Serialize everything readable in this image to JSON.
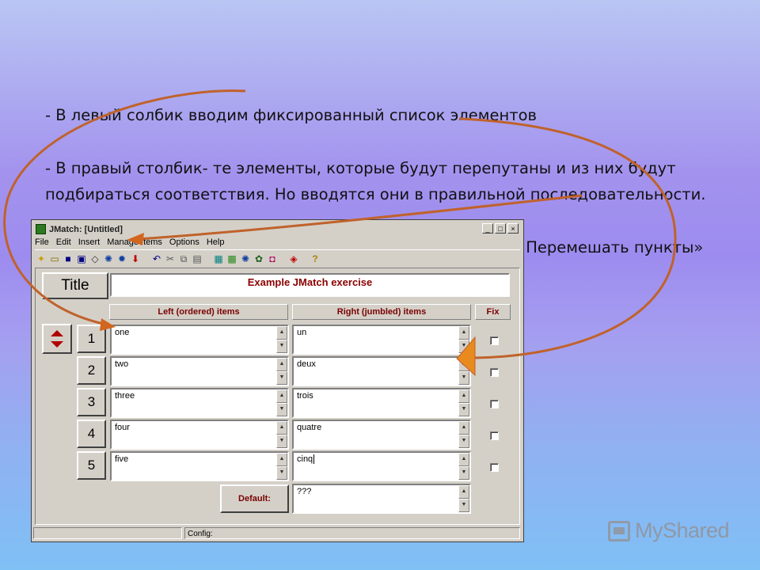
{
  "slide": {
    "lines": [
      "- В левый солбик вводим фиксированный список элементов",
      "- В правый столбик- те элементы, которые будут перепутаны и из них будут подбираться соответствия. Но вводятся они в правильной последовательности.",
      "- Во вкладке « Управление списком» выбираем команду « Перемешать пункты»"
    ]
  },
  "window": {
    "title": "JMatch: [Untitled]",
    "controls": [
      "_",
      "□",
      "×"
    ]
  },
  "menu": [
    "File",
    "Edit",
    "Insert",
    "Manage Items",
    "Options",
    "Help"
  ],
  "toolbar_icons": [
    "new-icon",
    "open-icon",
    "save-icon",
    "save-as-icon",
    "eraser-icon",
    "web-page-icon",
    "web-page-alt-icon",
    "export-icon",
    "undo-icon",
    "cut-icon",
    "copy-icon",
    "paste-icon",
    "config-icon",
    "image-icon",
    "web-export-icon",
    "hot-potatoes-icon",
    "gift-icon",
    "masher-icon",
    "help-icon"
  ],
  "title_button": "Title",
  "title_value": "Example JMatch exercise",
  "headers": {
    "left": "Left (ordered) items",
    "right": "Right (jumbled) items",
    "fix": "Fix"
  },
  "rows": [
    {
      "num": "1",
      "left": "one",
      "right": "un"
    },
    {
      "num": "2",
      "left": "two",
      "right": "deux"
    },
    {
      "num": "3",
      "left": "three",
      "right": "trois"
    },
    {
      "num": "4",
      "left": "four",
      "right": "quatre"
    },
    {
      "num": "5",
      "left": "five",
      "right": "cinq"
    }
  ],
  "default_label": "Default:",
  "default_value": "???",
  "status": {
    "config": "Config:"
  },
  "logo": {
    "text": "MyShared"
  },
  "colors": {
    "arrow": "#c0622a",
    "header_text": "#7a0000",
    "title_text": "#8b0000"
  }
}
